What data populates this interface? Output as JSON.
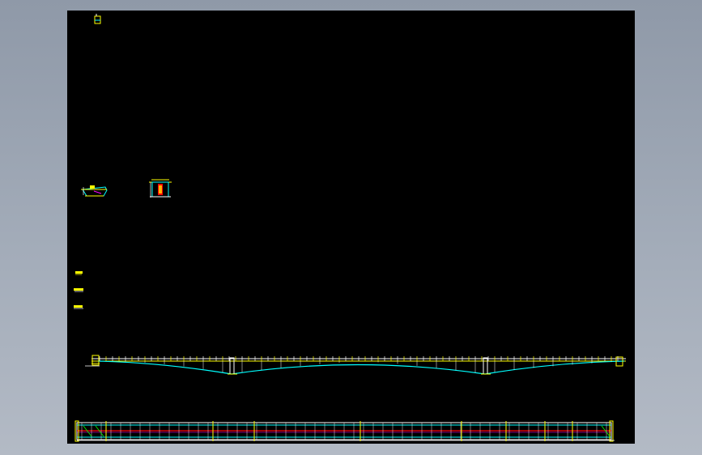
{
  "window": {
    "title": ""
  },
  "canvas": {
    "background": "#000000",
    "app_background": "#a3acb9",
    "colors": {
      "yellow": "#ffff00",
      "cyan": "#00ffff",
      "white": "#ffffff",
      "red": "#ff0000",
      "magenta": "#ff00ff",
      "green": "#00ff00"
    }
  },
  "drawing": {
    "components": [
      "title-block-marker",
      "cross-section-a",
      "cross-section-b",
      "note-tag-1",
      "note-tag-2",
      "note-tag-3",
      "bridge-elevation",
      "bridge-plan"
    ]
  }
}
